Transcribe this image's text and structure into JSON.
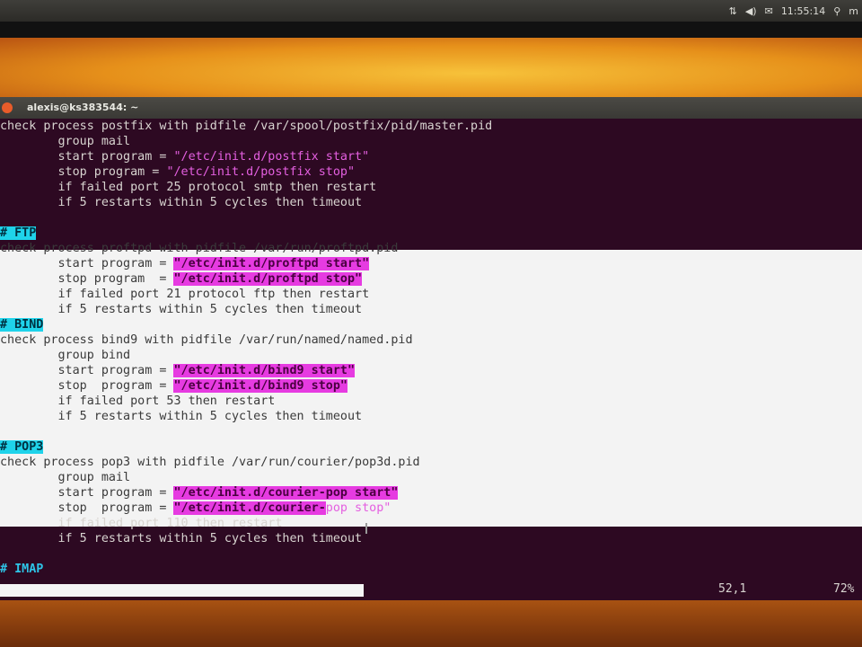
{
  "topbar": {
    "network_icon": "network-icon",
    "volume_icon": "volume-icon",
    "mail_icon": "mail-icon",
    "clock": "11:55:14",
    "search_icon": "search-icon",
    "user_partial": "m"
  },
  "window": {
    "title": "alexis@ks383544: ~"
  },
  "editor": {
    "lines": [
      {
        "pre": "check process postfix with pidfile /var/spool/postfix/pid/master.pid"
      },
      {
        "pre": "        group mail"
      },
      {
        "pre": "        start program = ",
        "str": "\"/etc/init.d/postfix start\""
      },
      {
        "pre": "        stop program = ",
        "str": "\"/etc/init.d/postfix stop\""
      },
      {
        "pre": "        if failed port 25 protocol smtp then restart"
      },
      {
        "pre": "        if 5 restarts within 5 cycles then timeout"
      },
      {
        "pre": ""
      },
      {
        "comment": "# FTP"
      },
      {
        "pre": "check process proftpd with pidfile /var/run/proftpd.pid"
      },
      {
        "pre": "        start program = ",
        "hl": "\"/etc/init.d/proftpd start\""
      },
      {
        "pre": "        stop program  = ",
        "hl": "\"/etc/init.d/proftpd stop\""
      },
      {
        "pre": "        if failed port 21 protocol ftp then restart"
      },
      {
        "pre": "        if 5 restarts within 5 cycles then timeout"
      },
      {
        "comment": "# BIND"
      },
      {
        "pre": "check process bind9 with pidfile /var/run/named/named.pid"
      },
      {
        "pre": "        group bind"
      },
      {
        "pre": "        start program = ",
        "hl": "\"/etc/init.d/bind9 start\""
      },
      {
        "pre": "        stop  program = ",
        "hl": "\"/etc/init.d/bind9 stop\""
      },
      {
        "pre": "        if failed port 53 then restart"
      },
      {
        "pre": "        if 5 restarts within 5 cycles then timeout"
      },
      {
        "pre": ""
      },
      {
        "comment": "# POP3"
      },
      {
        "pre": "check process pop3 with pidfile /var/run/courier/pop3d.pid"
      },
      {
        "pre": "        group mail"
      },
      {
        "pre": "        start program = ",
        "hl": "\"/etc/init.d/courier-pop start\""
      },
      {
        "pre": "        stop  program = ",
        "hl": "\"/etc/init.d/courier-",
        "str": "pop stop\""
      },
      {
        "pre": "        if failed port 110 then restart"
      },
      {
        "pre": "        if 5 restarts within 5 cycles then timeout"
      },
      {
        "pre": ""
      },
      {
        "comment": "# IMAP"
      }
    ]
  },
  "status": {
    "position": "52,1",
    "percent": "72%"
  }
}
